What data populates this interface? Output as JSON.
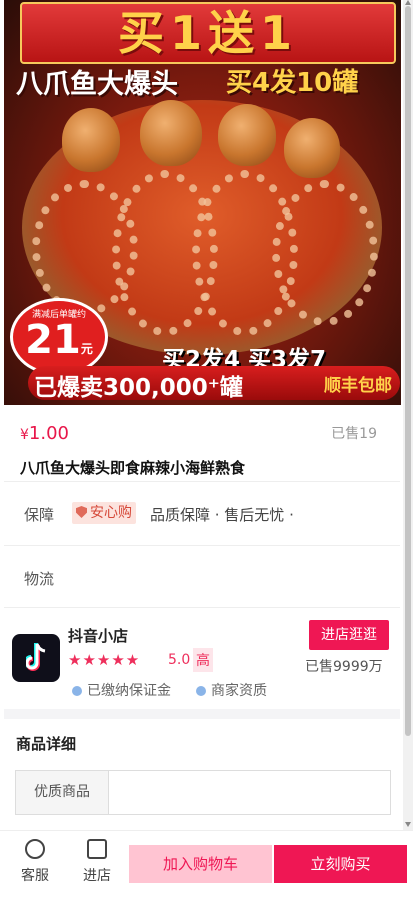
{
  "hero": {
    "banner_top": "买1送1",
    "line2_left": "八爪鱼大爆头",
    "line2_right": "买4发10罐",
    "badge_small": "满减后单罐约",
    "badge_price": "21",
    "badge_unit": "元",
    "line3": "买2发4  买3发7",
    "banner_bottom": "已爆卖300,000⁺罐",
    "banner_bottom_right": "顺丰包邮"
  },
  "product": {
    "currency": "¥",
    "price": "1.00",
    "sold": "已售19",
    "title": "八爪鱼大爆头即食麻辣小海鲜熟食"
  },
  "guarantee": {
    "label": "保障",
    "badge": "安心购",
    "text": "品质保障 · 售后无忧 ·"
  },
  "logistics": {
    "label": "物流"
  },
  "shop": {
    "name": "抖音小店",
    "stars": "★★★★★",
    "rating": "5.0",
    "rating_tag": "高",
    "cred1": "已缴纳保证金",
    "cred2": "商家资质",
    "visit_label": "进店逛逛",
    "sold": "已售9999万"
  },
  "details": {
    "title": "商品详细",
    "quality_label": "优质商品"
  },
  "bottom_bar": {
    "service": "客服",
    "store": "进店",
    "cart": "加入购物车",
    "buy": "立刻购买"
  },
  "colors": {
    "accent": "#ef1754",
    "price": "#e8174a"
  }
}
